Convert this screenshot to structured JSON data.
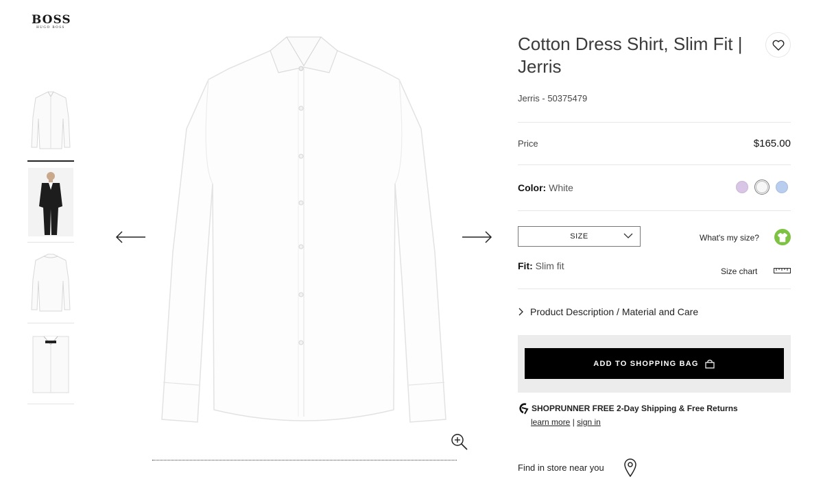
{
  "brand": {
    "logo_main": "BOSS",
    "logo_sub": "HUGO BOSS"
  },
  "gallery": {
    "thumbnails": [
      {
        "alt": "shirt-front"
      },
      {
        "alt": "model-suit"
      },
      {
        "alt": "shirt-back"
      },
      {
        "alt": "shirt-folded"
      }
    ],
    "active_index": 0
  },
  "product": {
    "title": "Cotton Dress Shirt, Slim Fit | Jerris",
    "sku": "Jerris - 50375479",
    "price_label": "Price",
    "price": "$165.00",
    "color_label": "Color:",
    "color_value": "White",
    "swatches": [
      {
        "name": "lavender",
        "hex": "#d9c5e6"
      },
      {
        "name": "white",
        "hex": "#f7f7f7",
        "selected": true
      },
      {
        "name": "light-blue",
        "hex": "#b9cdef"
      }
    ],
    "size_select_label": "SIZE",
    "whats_my_size": "What's my size?",
    "fit_label": "Fit:",
    "fit_value": "Slim fit",
    "size_chart": "Size chart",
    "description_toggle": "Product Description / Material and Care",
    "add_to_bag": "ADD TO SHOPPING BAG"
  },
  "shoprunner": {
    "text": "SHOPRUNNER FREE 2-Day Shipping & Free Returns",
    "learn_more": "learn more",
    "separator": "|",
    "sign_in": "sign in"
  },
  "store": {
    "find_label": "Find in store near you"
  },
  "colors": {
    "accent_green": "#7dc242",
    "button_black": "#000000",
    "panel_grey": "#ececec"
  }
}
